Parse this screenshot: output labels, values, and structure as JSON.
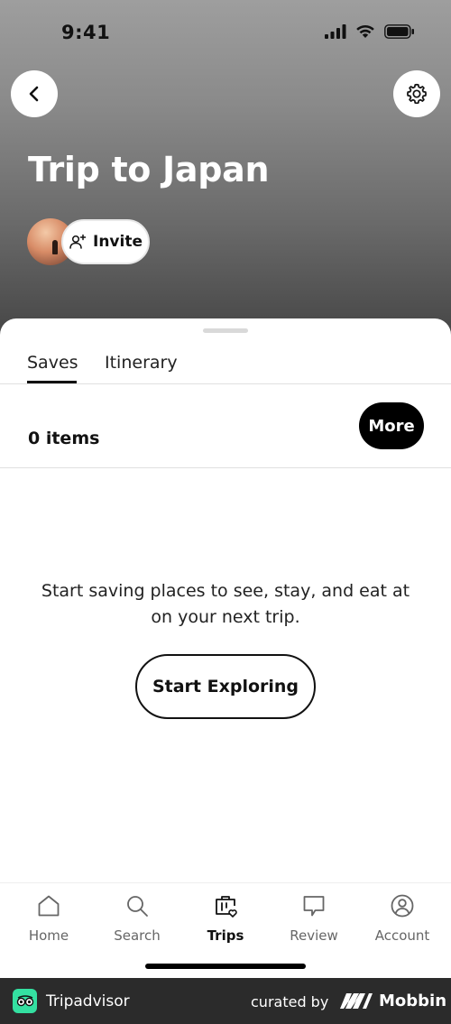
{
  "status_bar": {
    "time": "9:41"
  },
  "header": {
    "title": "Trip to Japan",
    "invite_label": "Invite"
  },
  "tabs": [
    {
      "label": "Saves",
      "active": true
    },
    {
      "label": "Itinerary",
      "active": false
    }
  ],
  "saves": {
    "count_label": "0 items",
    "more_label": "More"
  },
  "empty_state": {
    "message": "Start saving places to see, stay, and eat at on your next trip.",
    "button_label": "Start Exploring"
  },
  "bottom_nav": [
    {
      "label": "Home",
      "icon": "home-icon",
      "active": false
    },
    {
      "label": "Search",
      "icon": "search-icon",
      "active": false
    },
    {
      "label": "Trips",
      "icon": "trips-icon",
      "active": true
    },
    {
      "label": "Review",
      "icon": "review-icon",
      "active": false
    },
    {
      "label": "Account",
      "icon": "account-icon",
      "active": false
    }
  ],
  "footer": {
    "app_name": "Tripadvisor",
    "curated_by": "curated by",
    "brand": "Mobbin"
  },
  "colors": {
    "tripadvisor_green": "#34e0a1",
    "primary_dark": "#000000"
  }
}
